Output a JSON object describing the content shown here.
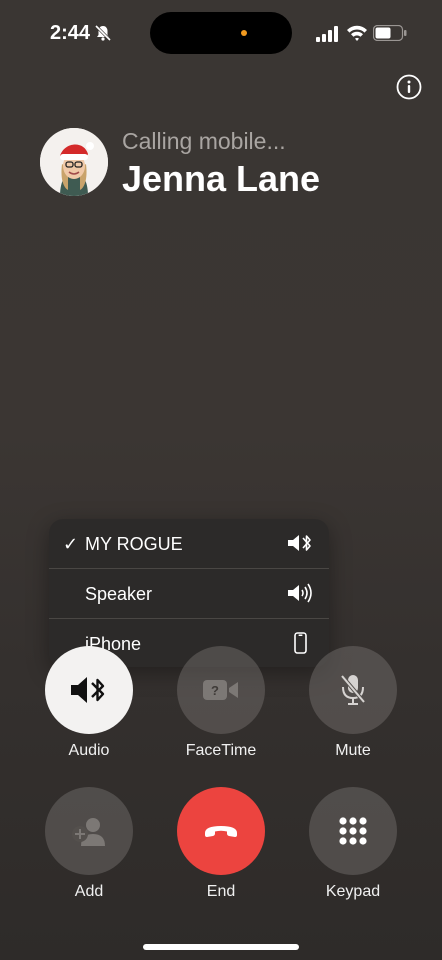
{
  "status_bar": {
    "time": "2:44",
    "icons": [
      "bell-slash-icon",
      "signal-icon",
      "wifi-icon",
      "battery-icon"
    ]
  },
  "call": {
    "status_text": "Calling mobile...",
    "contact_name": "Jenna Lane"
  },
  "audio_menu": {
    "items": [
      {
        "label": "MY ROGUE",
        "selected": true,
        "icon": "speaker-bluetooth-icon"
      },
      {
        "label": "Speaker",
        "selected": false,
        "icon": "speaker-wave-icon"
      },
      {
        "label": "iPhone",
        "selected": false,
        "icon": "iphone-icon"
      }
    ],
    "check_mark": "✓"
  },
  "controls": {
    "audio": "Audio",
    "facetime": "FaceTime",
    "mute": "Mute",
    "add": "Add",
    "end": "End",
    "keypad": "Keypad"
  },
  "colors": {
    "end_button": "#ec443f",
    "active_button": "#f3f2f1",
    "island_indicator": "#f29a1f"
  }
}
